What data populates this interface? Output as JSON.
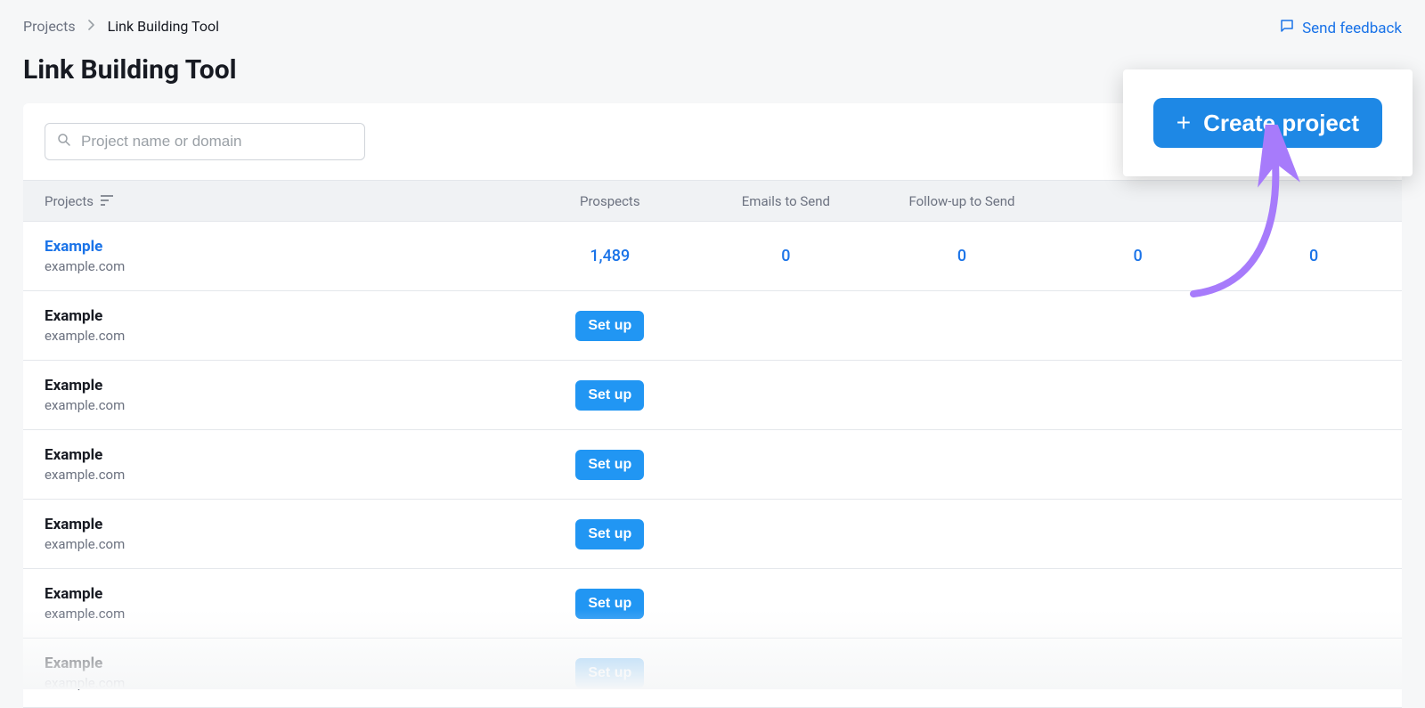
{
  "breadcrumbs": {
    "root": "Projects",
    "current": "Link Building Tool"
  },
  "feedback_label": "Send feedback",
  "page_title": "Link Building Tool",
  "search": {
    "placeholder": "Project name or domain",
    "value": ""
  },
  "create_button_label": "Create project",
  "table": {
    "headers": {
      "project": "Projects",
      "prospects": "Prospects",
      "emails": "Emails to Send",
      "followup": "Follow-up to Send"
    },
    "setup_label": "Set up",
    "rows": [
      {
        "name": "Example",
        "domain": "example.com",
        "link": true,
        "prospects": "1,489",
        "emails": "0",
        "followup": "0",
        "col4": "0",
        "col5": "0"
      },
      {
        "name": "Example",
        "domain": "example.com",
        "setup": true
      },
      {
        "name": "Example",
        "domain": "example.com",
        "setup": true
      },
      {
        "name": "Example",
        "domain": "example.com",
        "setup": true
      },
      {
        "name": "Example",
        "domain": "example.com",
        "setup": true
      },
      {
        "name": "Example",
        "domain": "example.com",
        "setup": true
      },
      {
        "name": "Example",
        "domain": "example.com",
        "setup": true,
        "faded": true
      }
    ]
  }
}
